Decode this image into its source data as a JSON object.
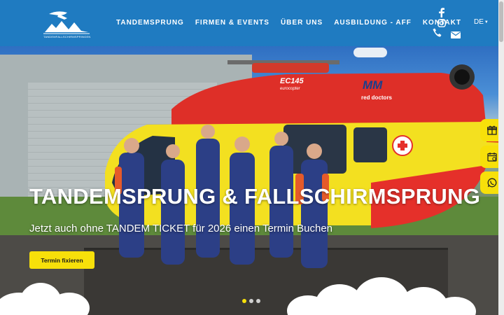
{
  "header": {
    "logo_icon": "skydiver-over-mountains-logo",
    "logo_text": "TANDEMFALLSCHIRMSPRINGEN",
    "nav": [
      {
        "label": "TANDEMSPRUNG"
      },
      {
        "label": "FIRMEN & EVENTS"
      },
      {
        "label": "ÜBER UNS"
      },
      {
        "label": "AUSBILDUNG - AFF"
      },
      {
        "label": "KONTAKT"
      }
    ],
    "social_icons": [
      "facebook-icon",
      "instagram-icon",
      "phone-icon",
      "mail-icon"
    ],
    "language": "DE",
    "colors": {
      "bar": "#1f7bc1",
      "text": "#ffffff"
    }
  },
  "hero": {
    "title": "TANDEMSPRUNG & FALLSCHIRMSPRUNG",
    "subtitle": "Jetzt auch ohne TANDEM TICKET für 2026 einen Termin Buchen",
    "cta_label": "Termin fixieren",
    "carousel": {
      "slides": 3,
      "active": 1
    },
    "helicopter_labels": {
      "model": "EC145",
      "brand": "eurocopter",
      "operator": "MM",
      "operator_sub": "red doctors"
    },
    "accent_color": "#f7e00a"
  },
  "side_buttons": [
    {
      "icon": "gift-icon"
    },
    {
      "icon": "calendar-icon"
    },
    {
      "icon": "whatsapp-icon"
    }
  ]
}
